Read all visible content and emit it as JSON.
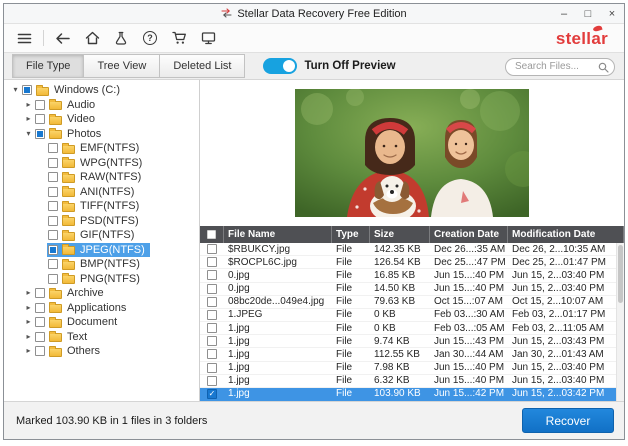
{
  "window": {
    "title": "Stellar Data Recovery Free Edition",
    "controls": {
      "minimize": "–",
      "maximize": "□",
      "close": "×"
    }
  },
  "brand": {
    "logo_text": "stellar",
    "color": "#e23c3c"
  },
  "toolbar": {
    "icons": [
      "menu-icon",
      "back-icon",
      "home-icon",
      "flask-icon",
      "help-icon",
      "cart-icon",
      "monitor-icon"
    ]
  },
  "tabs": [
    {
      "label": "File Type",
      "active": true
    },
    {
      "label": "Tree View",
      "active": false
    },
    {
      "label": "Deleted List",
      "active": false
    }
  ],
  "preview_toggle": {
    "label": "Turn Off Preview",
    "on": true,
    "color": "#17a2e0"
  },
  "search": {
    "placeholder": "Search Files..."
  },
  "tree": {
    "items": [
      {
        "label": "Windows (C:)",
        "level": 0,
        "state": "expanded",
        "check": "partial",
        "selected": false
      },
      {
        "label": "Audio",
        "level": 1,
        "state": "collapsed",
        "check": "none",
        "selected": false
      },
      {
        "label": "Video",
        "level": 1,
        "state": "collapsed",
        "check": "none",
        "selected": false
      },
      {
        "label": "Photos",
        "level": 1,
        "state": "expanded",
        "check": "partial",
        "selected": false
      },
      {
        "label": "EMF(NTFS)",
        "level": 2,
        "state": "leaf",
        "check": "none",
        "selected": false
      },
      {
        "label": "WPG(NTFS)",
        "level": 2,
        "state": "leaf",
        "check": "none",
        "selected": false
      },
      {
        "label": "RAW(NTFS)",
        "level": 2,
        "state": "leaf",
        "check": "none",
        "selected": false
      },
      {
        "label": "ANI(NTFS)",
        "level": 2,
        "state": "leaf",
        "check": "none",
        "selected": false
      },
      {
        "label": "TIFF(NTFS)",
        "level": 2,
        "state": "leaf",
        "check": "none",
        "selected": false
      },
      {
        "label": "PSD(NTFS)",
        "level": 2,
        "state": "leaf",
        "check": "none",
        "selected": false
      },
      {
        "label": "GIF(NTFS)",
        "level": 2,
        "state": "leaf",
        "check": "none",
        "selected": false
      },
      {
        "label": "JPEG(NTFS)",
        "level": 2,
        "state": "leaf",
        "check": "partial",
        "selected": true
      },
      {
        "label": "BMP(NTFS)",
        "level": 2,
        "state": "leaf",
        "check": "none",
        "selected": false
      },
      {
        "label": "PNG(NTFS)",
        "level": 2,
        "state": "leaf",
        "check": "none",
        "selected": false
      },
      {
        "label": "Archive",
        "level": 1,
        "state": "collapsed",
        "check": "none",
        "selected": false
      },
      {
        "label": "Applications",
        "level": 1,
        "state": "collapsed",
        "check": "none",
        "selected": false
      },
      {
        "label": "Document",
        "level": 1,
        "state": "collapsed",
        "check": "none",
        "selected": false
      },
      {
        "label": "Text",
        "level": 1,
        "state": "collapsed",
        "check": "none",
        "selected": false
      },
      {
        "label": "Others",
        "level": 1,
        "state": "collapsed",
        "check": "none",
        "selected": false
      }
    ]
  },
  "table": {
    "columns": [
      "File Name",
      "Type",
      "Size",
      "Creation Date",
      "Modification Date"
    ],
    "rows": [
      {
        "name": "$RBUKCY.jpg",
        "type": "File",
        "size": "142.35 KB",
        "created": "Dec 26...:35 AM",
        "modified": "Dec 26, 2...10:35 AM",
        "checked": false,
        "selected": false
      },
      {
        "name": "$ROCPL6C.jpg",
        "type": "File",
        "size": "126.54 KB",
        "created": "Dec 25...:47 PM",
        "modified": "Dec 25, 2...01:47 PM",
        "checked": false,
        "selected": false
      },
      {
        "name": "0.jpg",
        "type": "File",
        "size": "16.85 KB",
        "created": "Jun 15...:40 PM",
        "modified": "Jun 15, 2...03:40 PM",
        "checked": false,
        "selected": false
      },
      {
        "name": "0.jpg",
        "type": "File",
        "size": "14.50 KB",
        "created": "Jun 15...:40 PM",
        "modified": "Jun 15, 2...03:40 PM",
        "checked": false,
        "selected": false
      },
      {
        "name": "08bc20de...049e4.jpg",
        "type": "File",
        "size": "79.63 KB",
        "created": "Oct 15...:07 AM",
        "modified": "Oct 15, 2...10:07 AM",
        "checked": false,
        "selected": false
      },
      {
        "name": "1.JPEG",
        "type": "File",
        "size": "0 KB",
        "created": "Feb 03...:30 AM",
        "modified": "Feb 03, 2...01:17 PM",
        "checked": false,
        "selected": false
      },
      {
        "name": "1.jpg",
        "type": "File",
        "size": "0 KB",
        "created": "Feb 03...:05 AM",
        "modified": "Feb 03, 2...11:05 AM",
        "checked": false,
        "selected": false
      },
      {
        "name": "1.jpg",
        "type": "File",
        "size": "9.74 KB",
        "created": "Jun 15...:43 PM",
        "modified": "Jun 15, 2...03:43 PM",
        "checked": false,
        "selected": false
      },
      {
        "name": "1.jpg",
        "type": "File",
        "size": "112.55 KB",
        "created": "Jan 30...:44 AM",
        "modified": "Jan 30, 2...01:43 AM",
        "checked": false,
        "selected": false
      },
      {
        "name": "1.jpg",
        "type": "File",
        "size": "7.98 KB",
        "created": "Jun 15...:40 PM",
        "modified": "Jun 15, 2...03:40 PM",
        "checked": false,
        "selected": false
      },
      {
        "name": "1.jpg",
        "type": "File",
        "size": "6.32 KB",
        "created": "Jun 15...:40 PM",
        "modified": "Jun 15, 2...03:40 PM",
        "checked": false,
        "selected": false
      },
      {
        "name": "1.jpg",
        "type": "File",
        "size": "103.90 KB",
        "created": "Jun 15...:42 PM",
        "modified": "Jun 15, 2...03:42 PM",
        "checked": true,
        "selected": true
      }
    ]
  },
  "statusbar": {
    "status": "Marked 103.90 KB in 1 files in 3 folders",
    "recover_label": "Recover"
  },
  "colors": {
    "selection_blue": "#3e94e4",
    "tree_selection": "#4da0e8",
    "table_header_bg": "#4f5054",
    "recover_button": "#1170c6",
    "logo_red": "#e23c3c"
  }
}
